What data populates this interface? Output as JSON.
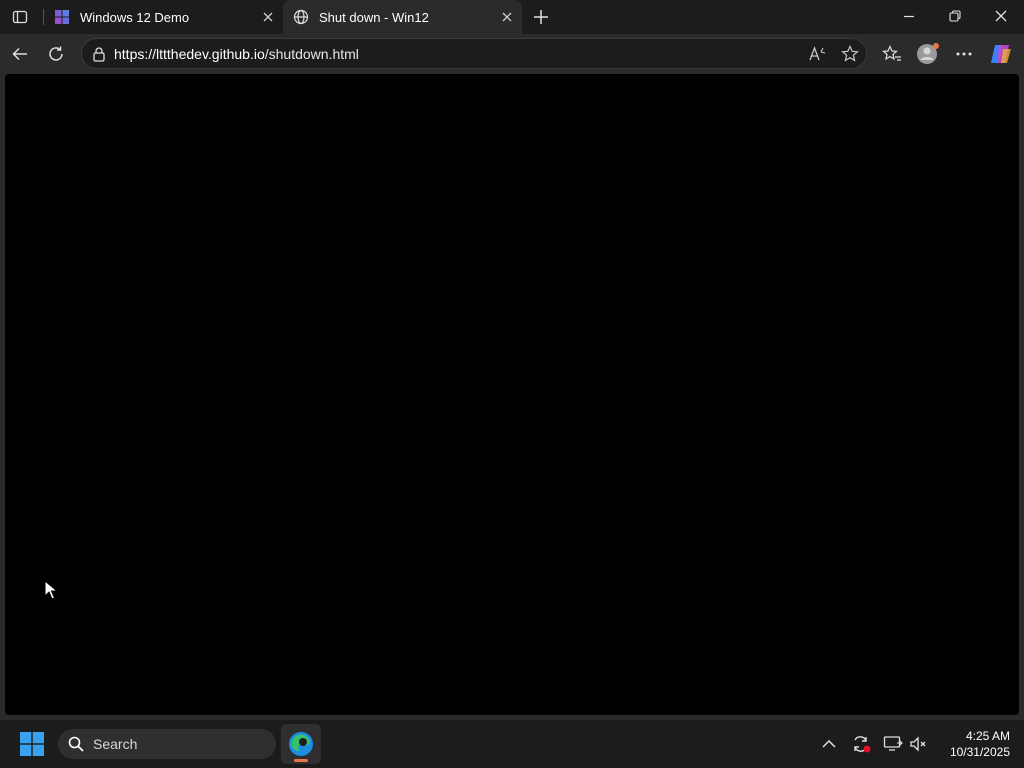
{
  "browser": {
    "tabs": [
      {
        "title": "Windows 12 Demo",
        "favicon": "windows12-demo-icon",
        "active": false
      },
      {
        "title": "Shut down - Win12",
        "favicon": "globe-icon",
        "active": true
      }
    ],
    "url_host": "https://lttthedev.github.io",
    "url_path": "/shutdown.html"
  },
  "taskbar": {
    "search_label": "Search",
    "time": "4:25 AM",
    "date": "10/31/2025"
  },
  "colors": {
    "page_background": "#000000",
    "chrome_dark": "#1c1c1c",
    "toolbar": "#2b2b2b",
    "edge_active_indicator": "#e8774b"
  }
}
